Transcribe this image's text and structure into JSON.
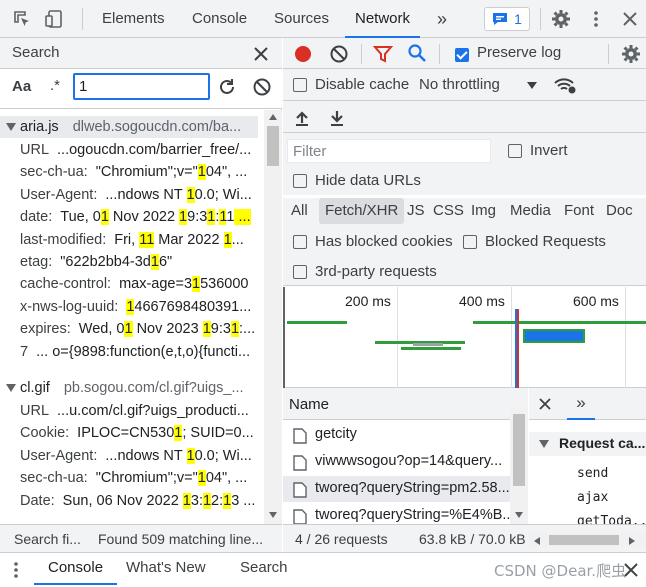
{
  "topbar": {
    "tabs": [
      "Elements",
      "Console",
      "Sources",
      "Network"
    ],
    "more": "»",
    "issues_count": "1"
  },
  "search": {
    "title": "Search",
    "case_toggle": "Aa",
    "regex_toggle": ".*",
    "query": "1",
    "results": [
      {
        "file": "aria.js",
        "url": "dlweb.sogoucdn.com/ba...",
        "lines": [
          {
            "k": "URL",
            "parts": [
              "...ogoucdn.com/barrier_free/..."
            ]
          },
          {
            "k": "sec-ch-ua:",
            "parts": [
              "\"Chromium\";v=\"",
              "1",
              "04\", ..."
            ]
          },
          {
            "k": "User-Agent:",
            "parts": [
              "...ndows NT ",
              "1",
              "0.0; Wi..."
            ]
          },
          {
            "k": "date:",
            "parts": [
              "Tue, 0",
              "1",
              " Nov 2022 ",
              "1",
              "9:3",
              "1",
              ":",
              "1",
              "1",
              " ..."
            ]
          },
          {
            "k": "last-modified:",
            "parts": [
              "Fri, ",
              "11",
              " Mar 2022 ",
              "1",
              "..."
            ]
          },
          {
            "k": "etag:",
            "parts": [
              "\"622b2bb4-3d",
              "1",
              "6\""
            ]
          },
          {
            "k": "cache-control:",
            "parts": [
              "max-age=3",
              "1",
              "536000"
            ]
          },
          {
            "k": "x-nws-log-uuid:",
            "parts": [
              "",
              "1",
              "4667698480391..."
            ]
          },
          {
            "k": "expires:",
            "parts": [
              "Wed, 0",
              "1",
              " Nov 2023 ",
              "1",
              "9:3",
              "1",
              ":..."
            ]
          },
          {
            "k": "7",
            "parts": [
              "... o={9898:function(e,t,o){functi..."
            ]
          }
        ]
      },
      {
        "file": "cl.gif",
        "url": "pb.sogou.com/cl.gif?uigs_...",
        "lines": [
          {
            "k": "URL",
            "parts": [
              "...u.com/cl.gif?uigs_producti..."
            ]
          },
          {
            "k": "Cookie:",
            "parts": [
              "IPLOC=CN530",
              "1",
              "; SUID=0..."
            ]
          },
          {
            "k": "User-Agent:",
            "parts": [
              "...ndows NT ",
              "1",
              "0.0; Wi..."
            ]
          },
          {
            "k": "sec-ch-ua:",
            "parts": [
              "\"Chromium\";v=\"",
              "1",
              "04\", ..."
            ]
          },
          {
            "k": "Date:",
            "parts": [
              "Sun, 06 Nov 2022 ",
              "1",
              "3:",
              "1",
              "2:",
              "1",
              "3 ..."
            ]
          }
        ]
      }
    ],
    "footer_left": "Search fi...",
    "footer_right": "Found 509 matching line..."
  },
  "network": {
    "preserve_log": "Preserve log",
    "disable_cache": "Disable cache",
    "throttling": "No throttling",
    "filter_placeholder": "Filter",
    "invert": "Invert",
    "hide_data_urls": "Hide data URLs",
    "types": [
      "All",
      "Fetch/XHR",
      "JS",
      "CSS",
      "Img",
      "Media",
      "Font",
      "Doc"
    ],
    "blocked_cookies": "Has blocked cookies",
    "blocked_requests": "Blocked Requests",
    "third_party": "3rd-party requests",
    "timeline_ticks": [
      "200 ms",
      "400 ms",
      "600 ms"
    ],
    "name_header": "Name",
    "requests": [
      "getcity",
      "viwwwsogou?op=14&query...",
      "tworeq?queryString=pm2.58...",
      "tworeq?queryString=%E4%B..."
    ],
    "status": "4 / 26 requests",
    "transfer": "63.8 kB / 70.0 kB",
    "detail_section": "Request ca...",
    "detail_items": [
      "send",
      "ajax",
      "getToda..."
    ]
  },
  "drawer": {
    "tabs": [
      "Console",
      "What's New",
      "Search"
    ]
  },
  "watermark": "CSDN @Dear.爬虫"
}
